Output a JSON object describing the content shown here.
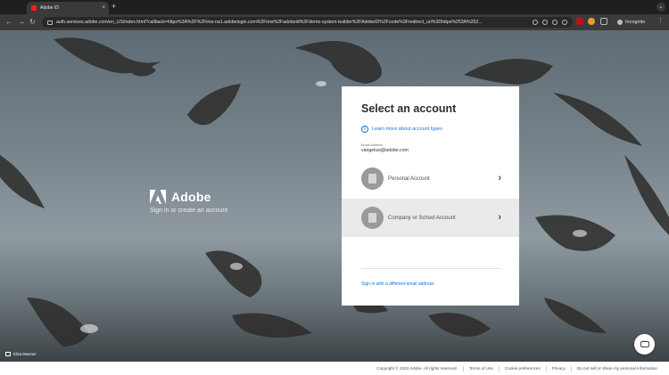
{
  "browser": {
    "tab": {
      "title": "Adobe ID",
      "favicon": "adobe-favicon",
      "close": "×"
    },
    "new_tab": "+",
    "tab_menu": "⌄",
    "nav": {
      "back": "←",
      "forward": "→",
      "reload": "↻"
    },
    "url": "auth.services.adobe.com/en_US/index.html?callback=https%3A%2F%2Fims-na1.adobelogin.com%2Fims%2Fadobeid%2Fdemo-system-builder%2FAdobeID%2Fcode%3Fredirect_uri%3Dhttps%253A%252...",
    "incognito_label": "Incognito",
    "menu": "⋮"
  },
  "brand": {
    "name": "Adobe",
    "tagline": "Sign in or create an account"
  },
  "card": {
    "title": "Select an account",
    "learn_more": "Learn more about account types",
    "email_label": "Email address",
    "email_value": "vangeluw@adobe.com",
    "accounts": [
      {
        "label": "Personal Account",
        "icon": "building-icon"
      },
      {
        "label": "Company or School Account",
        "icon": "building-icon"
      }
    ],
    "chevron": "›",
    "different_email": "Sign in with a different email address"
  },
  "photo_credit": "Eliza Meemer",
  "footer": {
    "copyright": "Copyright © 2024 Adobe. All rights reserved.",
    "links": [
      "Terms of Use",
      "Cookie preferences",
      "Privacy",
      "Do not sell or share my personal information"
    ]
  },
  "colors": {
    "accent": "#1473e6",
    "brand_red": "#e8251a"
  }
}
